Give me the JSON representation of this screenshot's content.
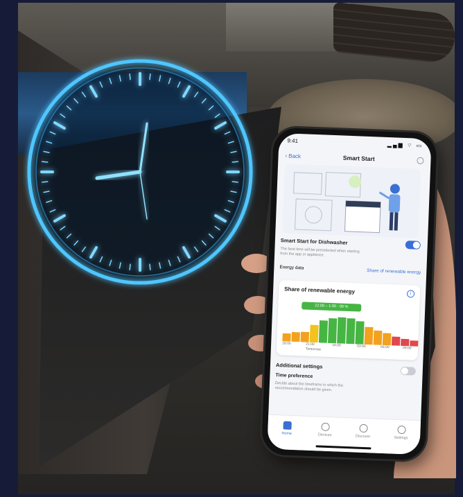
{
  "status_bar": {
    "time": "9:41",
    "indicators": "▂▄▆ ⌔ ▭"
  },
  "nav": {
    "back_label": "Back",
    "title": "Smart Start"
  },
  "smart_start": {
    "title": "Smart Start for Dishwasher",
    "enabled": true,
    "description_line1": "The best time will be preselected when starting",
    "description_line2": "from the app or appliance."
  },
  "energy": {
    "label": "Energy data",
    "link": "Share of renewable energy"
  },
  "card": {
    "title": "Share of renewable energy",
    "highlight_range": "22:00 – 1:00 · 09 %",
    "ticks": [
      "18:00",
      "21:00",
      "24:00",
      "03:00",
      "06:00",
      "09:00"
    ],
    "tick_sub": "Tomorrow"
  },
  "additional": {
    "title": "Additional settings",
    "toggle_enabled": false,
    "time_pref_title": "Time preference",
    "time_pref_desc_line1": "Decide about the timeframe in which the",
    "time_pref_desc_line2": "recommendation should be given."
  },
  "tabs": [
    {
      "label": "Home",
      "icon": "home-icon",
      "active": true
    },
    {
      "label": "Devices",
      "icon": "devices-icon",
      "active": false
    },
    {
      "label": "Discover",
      "icon": "discover-icon",
      "active": false
    },
    {
      "label": "Settings",
      "icon": "settings-icon",
      "active": false
    }
  ],
  "chart_data": {
    "type": "bar",
    "bars": [
      {
        "v": 0.25,
        "c": "#f2a21e"
      },
      {
        "v": 0.3,
        "c": "#f2a21e"
      },
      {
        "v": 0.32,
        "c": "#f2a21e"
      },
      {
        "v": 0.55,
        "c": "#f2c21e"
      },
      {
        "v": 0.7,
        "c": "#46b544"
      },
      {
        "v": 0.78,
        "c": "#46b544"
      },
      {
        "v": 0.82,
        "c": "#46b544"
      },
      {
        "v": 0.8,
        "c": "#46b544"
      },
      {
        "v": 0.72,
        "c": "#46b544"
      },
      {
        "v": 0.55,
        "c": "#f2a21e"
      },
      {
        "v": 0.45,
        "c": "#f2a21e"
      },
      {
        "v": 0.38,
        "c": "#f2a21e"
      },
      {
        "v": 0.28,
        "c": "#e0484d"
      },
      {
        "v": 0.22,
        "c": "#e0484d"
      },
      {
        "v": 0.18,
        "c": "#e0484d"
      }
    ]
  },
  "colors": {
    "accent": "#3b6fd1",
    "clock_glow": "#38b8ff",
    "renewable": "#46b544"
  }
}
